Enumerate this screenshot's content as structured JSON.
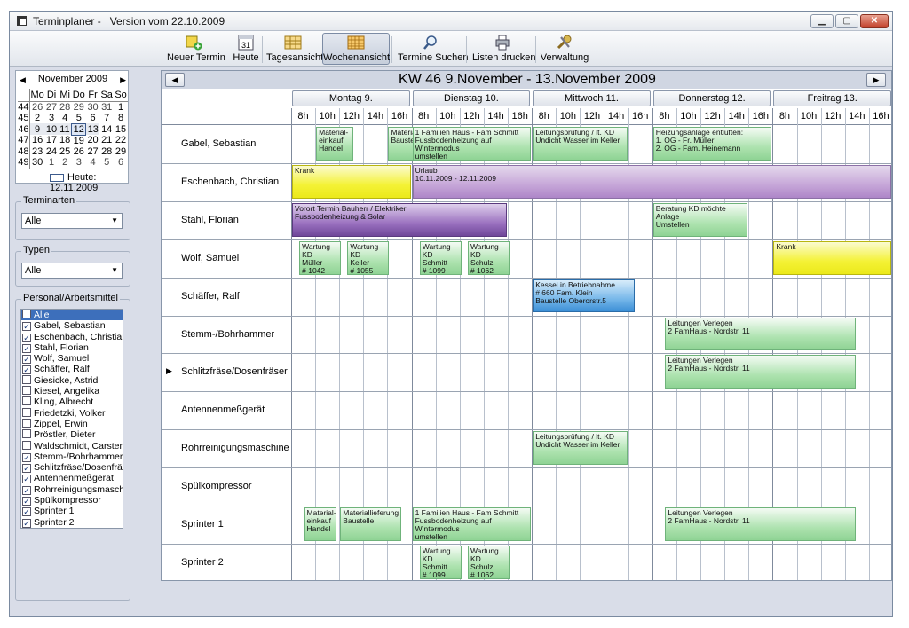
{
  "window": {
    "title": "Terminplaner -   Version vom 22.10.2009"
  },
  "toolbar": {
    "items": [
      {
        "name": "neuer-termin",
        "label": "Neuer Termin",
        "icon": "new-appointment-icon"
      },
      {
        "name": "heute",
        "label": "Heute",
        "icon": "calendar-31-icon"
      },
      {
        "name": "tagesansicht",
        "label": "Tagesansicht",
        "icon": "day-view-icon"
      },
      {
        "name": "wochenansicht",
        "label": "Wochenansicht",
        "icon": "week-view-icon",
        "active": true
      },
      {
        "name": "termine-suchen",
        "label": "Termine Suchen",
        "icon": "magnifier-icon"
      },
      {
        "name": "listen-drucken",
        "label": "Listen drucken",
        "icon": "printer-icon"
      },
      {
        "name": "verwaltung",
        "label": "Verwaltung",
        "icon": "tools-icon"
      }
    ]
  },
  "calendar": {
    "month": "November 2009",
    "prev": "◀",
    "next": "▶",
    "dayheaders": [
      "Mo",
      "Di",
      "Mi",
      "Do",
      "Fr",
      "Sa",
      "So"
    ],
    "weeks": [
      {
        "wk": "44",
        "days": [
          "26",
          "27",
          "28",
          "29",
          "30",
          "31",
          "1"
        ]
      },
      {
        "wk": "45",
        "days": [
          "2",
          "3",
          "4",
          "5",
          "6",
          "7",
          "8"
        ]
      },
      {
        "wk": "46",
        "days": [
          "9",
          "10",
          "11",
          "12",
          "13",
          "14",
          "15"
        ]
      },
      {
        "wk": "47",
        "days": [
          "16",
          "17",
          "18",
          "19",
          "20",
          "21",
          "22"
        ]
      },
      {
        "wk": "48",
        "days": [
          "23",
          "24",
          "25",
          "26",
          "27",
          "28",
          "29"
        ]
      },
      {
        "wk": "49",
        "days": [
          "30",
          "1",
          "2",
          "3",
          "4",
          "5",
          "6"
        ]
      }
    ],
    "today_label": "Heute: 12.11.2009"
  },
  "terminarten": {
    "label": "Terminarten",
    "value": "Alle"
  },
  "typen": {
    "label": "Typen",
    "value": "Alle"
  },
  "personal": {
    "label": "Personal/Arbeitsmittel",
    "items": [
      {
        "label": "Alle",
        "checked": false,
        "selected": true
      },
      {
        "label": "Gabel, Sebastian",
        "checked": true
      },
      {
        "label": "Eschenbach, Christian",
        "checked": true
      },
      {
        "label": "Stahl, Florian",
        "checked": true
      },
      {
        "label": "Wolf, Samuel",
        "checked": true
      },
      {
        "label": "Schäffer, Ralf",
        "checked": true
      },
      {
        "label": "Giesicke, Astrid",
        "checked": false
      },
      {
        "label": "Kiesel, Angelika",
        "checked": false
      },
      {
        "label": "Kling, Albrecht",
        "checked": false
      },
      {
        "label": "Friedetzki, Volker",
        "checked": false
      },
      {
        "label": "Zippel, Erwin",
        "checked": false
      },
      {
        "label": "Pröstler, Dieter",
        "checked": false
      },
      {
        "label": "Waldschmidt, Carsten",
        "checked": false
      },
      {
        "label": "Stemm-/Bohrhammer",
        "checked": true
      },
      {
        "label": "Schlitzfräse/Dosenfräse",
        "checked": true
      },
      {
        "label": "Antennenmeßgerät",
        "checked": true
      },
      {
        "label": "Rohrreinigungsmaschin",
        "checked": true
      },
      {
        "label": "Spülkompressor",
        "checked": true
      },
      {
        "label": "Sprinter 1",
        "checked": true
      },
      {
        "label": "Sprinter 2",
        "checked": true
      }
    ]
  },
  "week": {
    "title": "KW 46   9.November - 13.November 2009",
    "prev": "◀",
    "next": "▶",
    "days": [
      "Montag 9.",
      "Dienstag 10.",
      "Mittwoch 11.",
      "Donnerstag 12.",
      "Freitrag 13."
    ],
    "hours": [
      "8h",
      "10h",
      "12h",
      "14h",
      "16h"
    ]
  },
  "rows": [
    {
      "name": "Gabel, Sebastian"
    },
    {
      "name": "Eschenbach, Christian"
    },
    {
      "name": "Stahl, Florian"
    },
    {
      "name": "Wolf, Samuel"
    },
    {
      "name": "Schäffer, Ralf"
    },
    {
      "name": "Stemm-/Bohrhammer"
    },
    {
      "name": "Schlitzfräse/Dosenfräser",
      "marker": "▶"
    },
    {
      "name": "Antennenmeßgerät"
    },
    {
      "name": "Rohrreinigungsmaschine"
    },
    {
      "name": "Spülkompressor"
    },
    {
      "name": "Sprinter 1"
    },
    {
      "name": "Sprinter 2"
    }
  ],
  "events": [
    {
      "row": 0,
      "day": 0,
      "start": 1,
      "len": 1.6,
      "color": "green",
      "text": "Material-\neinkauf\nHandel"
    },
    {
      "row": 0,
      "day": 0,
      "start": 4,
      "len": 3,
      "color": "green",
      "text": "Materiallieferung\nBaustelle"
    },
    {
      "row": 0,
      "day": 1,
      "start": 0,
      "len": 5,
      "color": "green",
      "text": "1 Familien Haus - Fam Schmitt\nFussbodenheizung auf Wintermodus\numstellen"
    },
    {
      "row": 0,
      "day": 2,
      "start": 0,
      "len": 4,
      "color": "green",
      "text": "Leitungsprüfung / lt. KD\nUndicht Wasser im Keller"
    },
    {
      "row": 0,
      "day": 3,
      "start": 0,
      "len": 5,
      "color": "green",
      "text": "Heizungsanlage entlüften:\n1. OG - Fr. Müller\n2. OG - Fam. Heinemann"
    },
    {
      "row": 1,
      "day": 0,
      "start": 0,
      "len": 5,
      "color": "yellow",
      "text": "Krank"
    },
    {
      "row": 1,
      "day": 1,
      "start": 0,
      "len": 20,
      "color": "lilac",
      "text": "Urlaub\n10.11.2009 - 12.11.2009"
    },
    {
      "row": 2,
      "day": 0,
      "start": 0,
      "len": 9,
      "color": "purple",
      "text": "Vorort Termin Bauherr / Elektriker\nFussbodenheizung & Solar"
    },
    {
      "row": 2,
      "day": 3,
      "start": 0,
      "len": 4,
      "color": "green",
      "text": "Beratung KD möchte Anlage\nUmstellen"
    },
    {
      "row": 3,
      "day": 0,
      "start": 0.3,
      "len": 1.8,
      "color": "green",
      "text": "Wartung KD\nMüller\n# 1042"
    },
    {
      "row": 3,
      "day": 0,
      "start": 2.3,
      "len": 1.8,
      "color": "green",
      "text": "Wartung KD\nKeller\n# 1055"
    },
    {
      "row": 3,
      "day": 1,
      "start": 0.3,
      "len": 1.8,
      "color": "green",
      "text": "Wartung KD\nSchmitt\n# 1099"
    },
    {
      "row": 3,
      "day": 1,
      "start": 2.3,
      "len": 1.8,
      "color": "green",
      "text": "Wartung KD\nSchulz\n# 1062"
    },
    {
      "row": 3,
      "day": 4,
      "start": 0,
      "len": 5,
      "color": "yellow",
      "text": "Krank"
    },
    {
      "row": 4,
      "day": 2,
      "start": 0,
      "len": 4.3,
      "color": "blue",
      "text": "Kessel in Betriebnahme\n# 660 Fam. Klein\nBaustelle Oberorstr.5"
    },
    {
      "row": 5,
      "day": 3,
      "start": 0.5,
      "len": 8,
      "color": "green",
      "text": "Leitungen Verlegen\n2 FamHaus - Nordstr. 11"
    },
    {
      "row": 6,
      "day": 3,
      "start": 0.5,
      "len": 8,
      "color": "green",
      "text": "Leitungen Verlegen\n2 FamHaus - Nordstr. 11"
    },
    {
      "row": 8,
      "day": 2,
      "start": 0,
      "len": 4,
      "color": "green",
      "text": "Leitungsprüfung / lt. KD\nUndicht Wasser im Keller"
    },
    {
      "row": 10,
      "day": 0,
      "start": 0.5,
      "len": 1.4,
      "color": "green",
      "text": "Material-\neinkauf\nHandel"
    },
    {
      "row": 10,
      "day": 0,
      "start": 2,
      "len": 2.6,
      "color": "green",
      "text": "Materiallieferung\nBaustelle"
    },
    {
      "row": 10,
      "day": 1,
      "start": 0,
      "len": 5,
      "color": "green",
      "text": "1 Familien Haus - Fam Schmitt\nFussbodenheizung auf Wintermodus\numstellen"
    },
    {
      "row": 10,
      "day": 3,
      "start": 0.5,
      "len": 8,
      "color": "green",
      "text": "Leitungen Verlegen\n2 FamHaus - Nordstr. 11"
    },
    {
      "row": 11,
      "day": 1,
      "start": 0.3,
      "len": 1.8,
      "color": "green",
      "text": "Wartung KD\nSchmitt\n# 1099"
    },
    {
      "row": 11,
      "day": 1,
      "start": 2.3,
      "len": 1.8,
      "color": "green",
      "text": "Wartung KD\nSchulz\n# 1062"
    }
  ]
}
